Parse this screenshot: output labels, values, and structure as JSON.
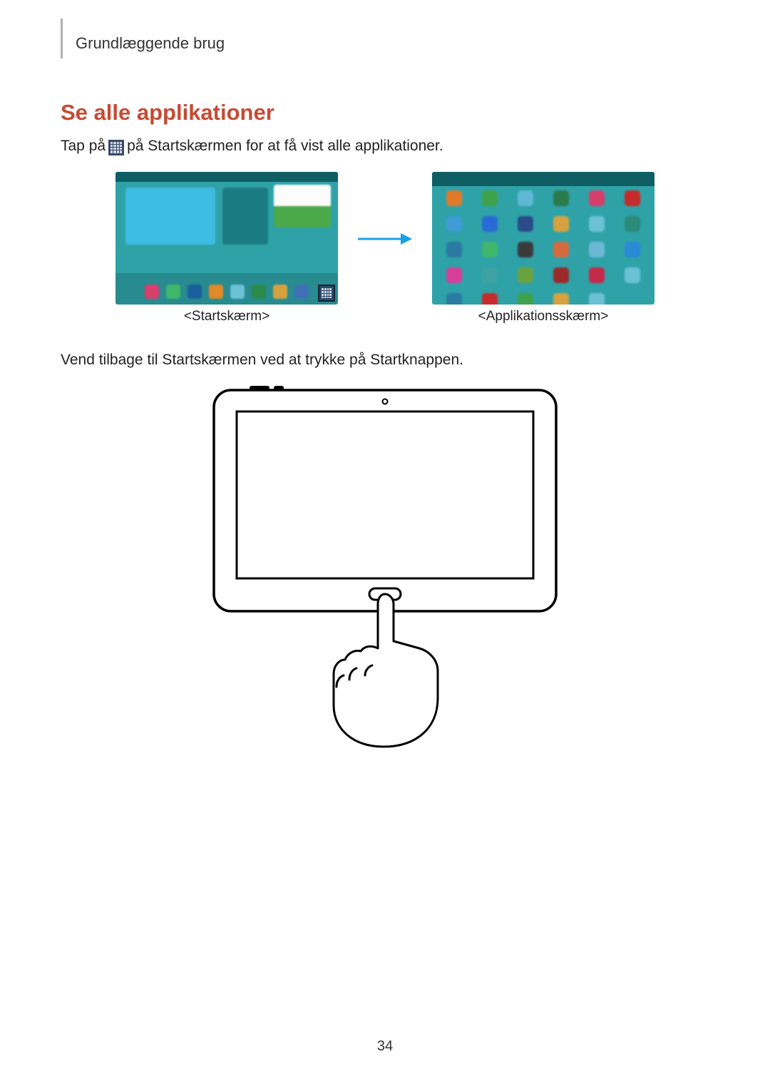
{
  "header": {
    "breadcrumb": "Grundlæggende brug"
  },
  "section": {
    "title": "Se alle applikationer"
  },
  "para1": {
    "pre": "Tap på ",
    "post": " på Startskærmen for at få vist alle applikationer."
  },
  "captions": {
    "home": "<Startskærm>",
    "apps": "<Applikationsskærm>"
  },
  "para2": "Vend tilbage til Startskærmen ved at trykke på Startknappen.",
  "page_number": "34",
  "app_colors": [
    "#e07a2a",
    "#3fa24a",
    "#5fb8d6",
    "#2a7a4a",
    "#d63f6a",
    "#c62a2a",
    "#3f9cd6",
    "#2a6ad6",
    "#2a4a8a",
    "#d6a23f",
    "#6bc1d6",
    "#2a8a7a",
    "#2a7aa2",
    "#3fb66a",
    "#3a3a3a",
    "#d66a3f",
    "#6bb8d6",
    "#2a8ad6",
    "#d63f9c",
    "#3fa2a2",
    "#6aa23f",
    "#9c2a2a",
    "#c62a4a",
    "#6bc1d6",
    "#2a7aa2",
    "#c62a2a",
    "#3fa24a",
    "#d6a23f",
    "#6bc1d6",
    "#2fa2a8"
  ]
}
